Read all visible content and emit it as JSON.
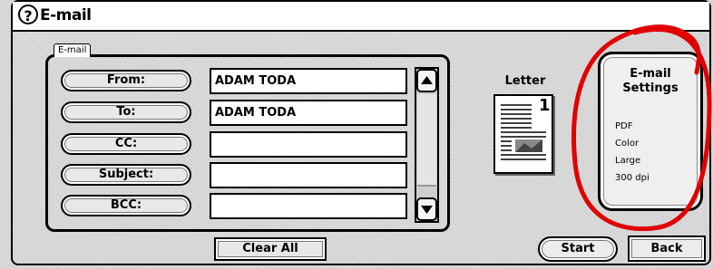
{
  "window": {
    "title": "E-mail",
    "help_glyph": "?"
  },
  "email_group": {
    "label": "E-mail",
    "fields": [
      {
        "label": "From:",
        "value": "ADAM TODA"
      },
      {
        "label": "To:",
        "value": "ADAM TODA"
      },
      {
        "label": "CC:",
        "value": ""
      },
      {
        "label": "Subject:",
        "value": ""
      },
      {
        "label": "BCC:",
        "value": ""
      }
    ]
  },
  "clear_all_label": "Clear All",
  "preview": {
    "paper_label": "Letter",
    "page_number": "1"
  },
  "email_settings": {
    "title_line1": "E-mail",
    "title_line2": "Settings",
    "format": "PDF",
    "color": "Color",
    "size": "Large",
    "resolution": "300 dpi"
  },
  "start_label": "Start",
  "back_label": "Back",
  "colors": {
    "annotation_circle": "#e00000",
    "background_hatch": "#dcdcdc"
  },
  "icons": [
    "help-icon",
    "scroll-up-icon",
    "scroll-down-icon",
    "document-thumbnail-icon"
  ]
}
